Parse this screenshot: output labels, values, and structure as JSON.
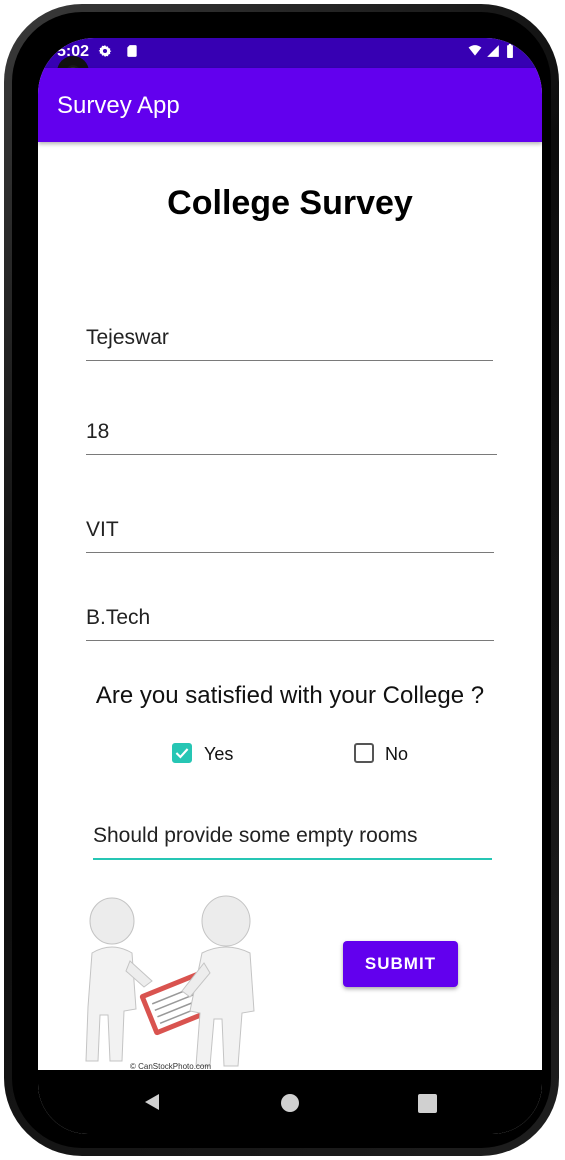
{
  "status_bar": {
    "time": "5:02"
  },
  "app_bar": {
    "title": "Survey App"
  },
  "form": {
    "heading": "College Survey",
    "name": "Tejeswar",
    "age": "18",
    "college": "VIT",
    "degree": "B.Tech",
    "question": "Are you satisfied with your College ?",
    "options": [
      {
        "label": "Yes",
        "checked": true
      },
      {
        "label": "No",
        "checked": false
      }
    ],
    "feedback": "Should provide some empty rooms",
    "submit_label": "SUBMIT"
  },
  "illustration": {
    "credit": "© CanStockPhoto.com"
  },
  "colors": {
    "accent": "#6200ee",
    "status_bar": "#3700b3",
    "check": "#26c6b4"
  },
  "icons": [
    "settings-icon",
    "sd-card-icon",
    "wifi-icon",
    "signal-icon",
    "battery-icon",
    "back-icon",
    "home-icon",
    "recents-icon"
  ]
}
